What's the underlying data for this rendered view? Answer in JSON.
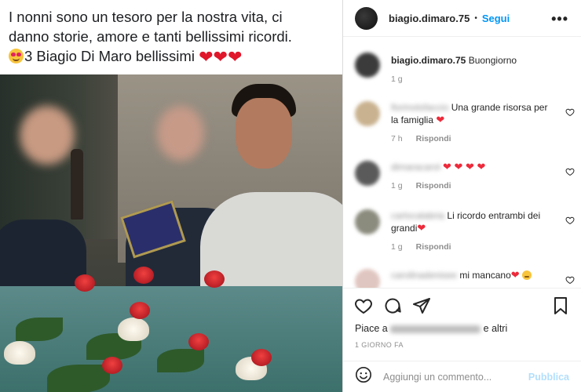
{
  "post": {
    "caption_line1": "I nonni sono un tesoro per la nostra vita, ci",
    "caption_line2": "danno storie, amore e tanti bellissimi ricordi.",
    "caption_line3": "3 Biagio Di Maro bellissimi",
    "caption_hearts": "❤❤❤"
  },
  "header": {
    "username": "biagio.dimaro.75",
    "separator": "•",
    "follow_label": "Segui",
    "more_label": "•••"
  },
  "comments": [
    {
      "user": "biagio.dimaro.75",
      "text": "Buongiorno",
      "time": "1 g",
      "reply": "",
      "user_blurred": false
    },
    {
      "user": "fiorinotsfaccio",
      "text": "Una grande risorsa per la famiglia ",
      "text_suffix": "❤",
      "time": "7 h",
      "reply": "Rispondi",
      "user_blurred": true
    },
    {
      "user": "dimaracarol",
      "text": "",
      "text_suffix": "❤ ❤ ❤ ❤",
      "time": "1 g",
      "reply": "Rispondi",
      "user_blurred": true
    },
    {
      "user": "carlocalabria",
      "text": "Li ricordo entrambi dei grandi",
      "text_suffix": "❤",
      "time": "1 g",
      "reply": "Rispondi",
      "user_blurred": true
    },
    {
      "user": "carolinadenisee",
      "text": "mi mancano",
      "text_suffix": "❤",
      "time": "",
      "reply": "",
      "user_blurred": true
    }
  ],
  "likes": {
    "prefix": "Piace a",
    "suffix": "e altri"
  },
  "time_ago": "1 GIORNO FA",
  "composer": {
    "placeholder": "Aggiungi un commento...",
    "publish_label": "Pubblica"
  },
  "colors": {
    "accent": "#0095f6",
    "publish_disabled": "#b2dffc",
    "heart": "#ed2a3a"
  }
}
